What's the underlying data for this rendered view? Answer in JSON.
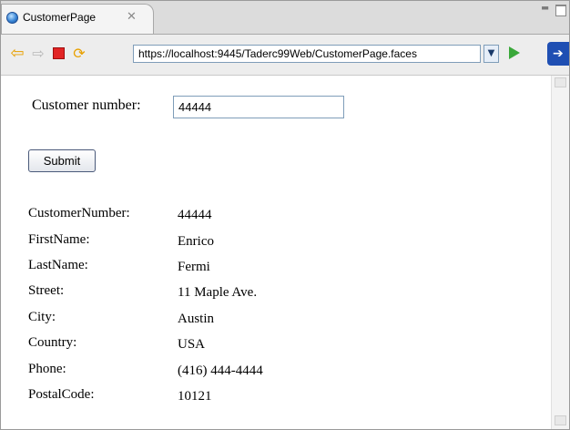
{
  "tab": {
    "title": "CustomerPage",
    "close_glyph": "✕"
  },
  "toolbar": {
    "url": "https://localhost:9445/Taderc99Web/CustomerPage.faces",
    "icons": [
      "back-arrow-icon",
      "forward-arrow-icon",
      "stop-icon",
      "refresh-icon",
      "go-icon",
      "external-browser-icon"
    ]
  },
  "form": {
    "customer_number_label": "Customer number:",
    "customer_number_value": "44444",
    "submit_label": "Submit"
  },
  "details": [
    {
      "label": "CustomerNumber:",
      "value": "44444"
    },
    {
      "label": "FirstName:",
      "value": "Enrico"
    },
    {
      "label": "LastName:",
      "value": "Fermi"
    },
    {
      "label": "Street:",
      "value": "11 Maple Ave."
    },
    {
      "label": "City:",
      "value": "Austin"
    },
    {
      "label": "Country:",
      "value": "USA"
    },
    {
      "label": "Phone:",
      "value": "(416) 444-4444"
    },
    {
      "label": "PostalCode:",
      "value": "10121"
    }
  ],
  "colors": {
    "stop": "#e22424",
    "go": "#3aa83a",
    "nav": "#e8a000"
  }
}
